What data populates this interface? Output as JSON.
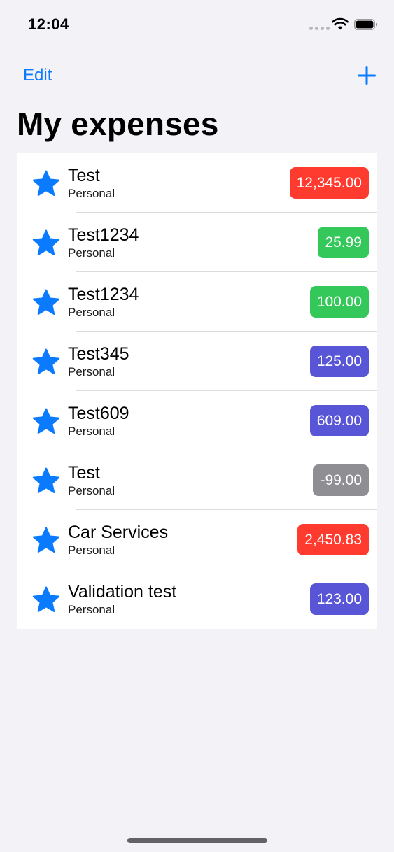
{
  "status_bar": {
    "time": "12:04"
  },
  "nav": {
    "edit_label": "Edit",
    "add_icon": "plus-icon"
  },
  "title": "My expenses",
  "colors": {
    "accent": "#0a7aff",
    "red": "#ff3b30",
    "green": "#34c759",
    "purple": "#5856d6",
    "gray": "#8e8e93"
  },
  "expenses": [
    {
      "name": "Test",
      "category": "Personal",
      "amount": "12,345.00",
      "badge_color": "#ff3b30"
    },
    {
      "name": "Test1234",
      "category": "Personal",
      "amount": "25.99",
      "badge_color": "#34c759"
    },
    {
      "name": "Test1234",
      "category": "Personal",
      "amount": "100.00",
      "badge_color": "#34c759"
    },
    {
      "name": "Test345",
      "category": "Personal",
      "amount": "125.00",
      "badge_color": "#5856d6"
    },
    {
      "name": "Test609",
      "category": "Personal",
      "amount": "609.00",
      "badge_color": "#5856d6"
    },
    {
      "name": "Test",
      "category": "Personal",
      "amount": "-99.00",
      "badge_color": "#8e8e93"
    },
    {
      "name": "Car Services",
      "category": "Personal",
      "amount": "2,450.83",
      "badge_color": "#ff3b30"
    },
    {
      "name": "Validation test",
      "category": "Personal",
      "amount": "123.00",
      "badge_color": "#5856d6"
    }
  ]
}
